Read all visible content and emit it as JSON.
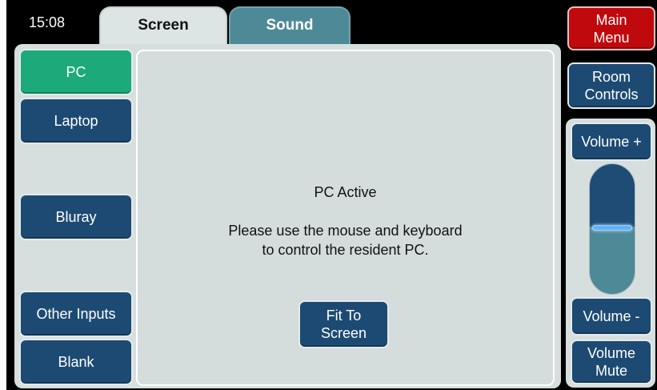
{
  "header": {
    "time": "15:08",
    "tabs": [
      {
        "label": "Screen",
        "selected": true
      },
      {
        "label": "Sound",
        "selected": false
      }
    ],
    "main_menu_label": "Main\nMenu"
  },
  "sources": [
    {
      "label": "PC",
      "active": true
    },
    {
      "label": "Laptop",
      "active": false
    },
    {
      "label": "Bluray",
      "active": false
    },
    {
      "label": "Other Inputs",
      "active": false
    },
    {
      "label": "Blank",
      "active": false
    }
  ],
  "main": {
    "status_title": "PC Active",
    "message_line1": "Please use the mouse and keyboard",
    "message_line2": "to control the resident PC.",
    "fit_button": "Fit To\nScreen"
  },
  "right": {
    "room_controls": "Room\nControls",
    "volume_up": "Volume +",
    "volume_down": "Volume -",
    "volume_mute": "Volume\nMute",
    "volume_level": 0.5
  },
  "colors": {
    "accent_active": "#1daa7b",
    "button_blue": "#1d4a72",
    "main_menu_red": "#c0090d",
    "panel_grey": "#d7dfde",
    "sound_tab": "#4e8997"
  }
}
